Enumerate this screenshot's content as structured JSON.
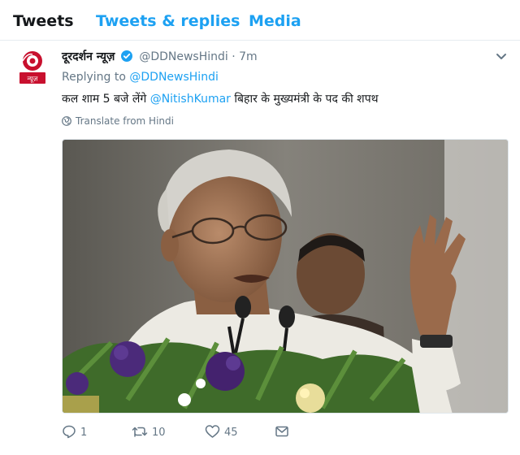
{
  "tabs": {
    "tweets": "Tweets",
    "replies": "Tweets & replies",
    "media": "Media"
  },
  "tweet": {
    "avatar_text": "न्यूज़",
    "name": "दूरदर्शन न्यूज़",
    "handle": "@DDNewsHindi",
    "separator": "·",
    "time": "7m",
    "replying_prefix": "Replying to",
    "replying_to": "@DDNewsHindi",
    "text_before": "कल शाम 5 बजे लेंगे",
    "mention": "@NitishKumar",
    "text_after": "बिहार के मुख्यमंत्री के पद की शपथ",
    "translate": "Translate from Hindi",
    "stats": {
      "replies": "1",
      "retweets": "10",
      "likes": "45"
    }
  },
  "colors": {
    "accent": "#1da1f2",
    "muted": "#657786",
    "text": "#14171a",
    "dd_red": "#c8102e"
  }
}
